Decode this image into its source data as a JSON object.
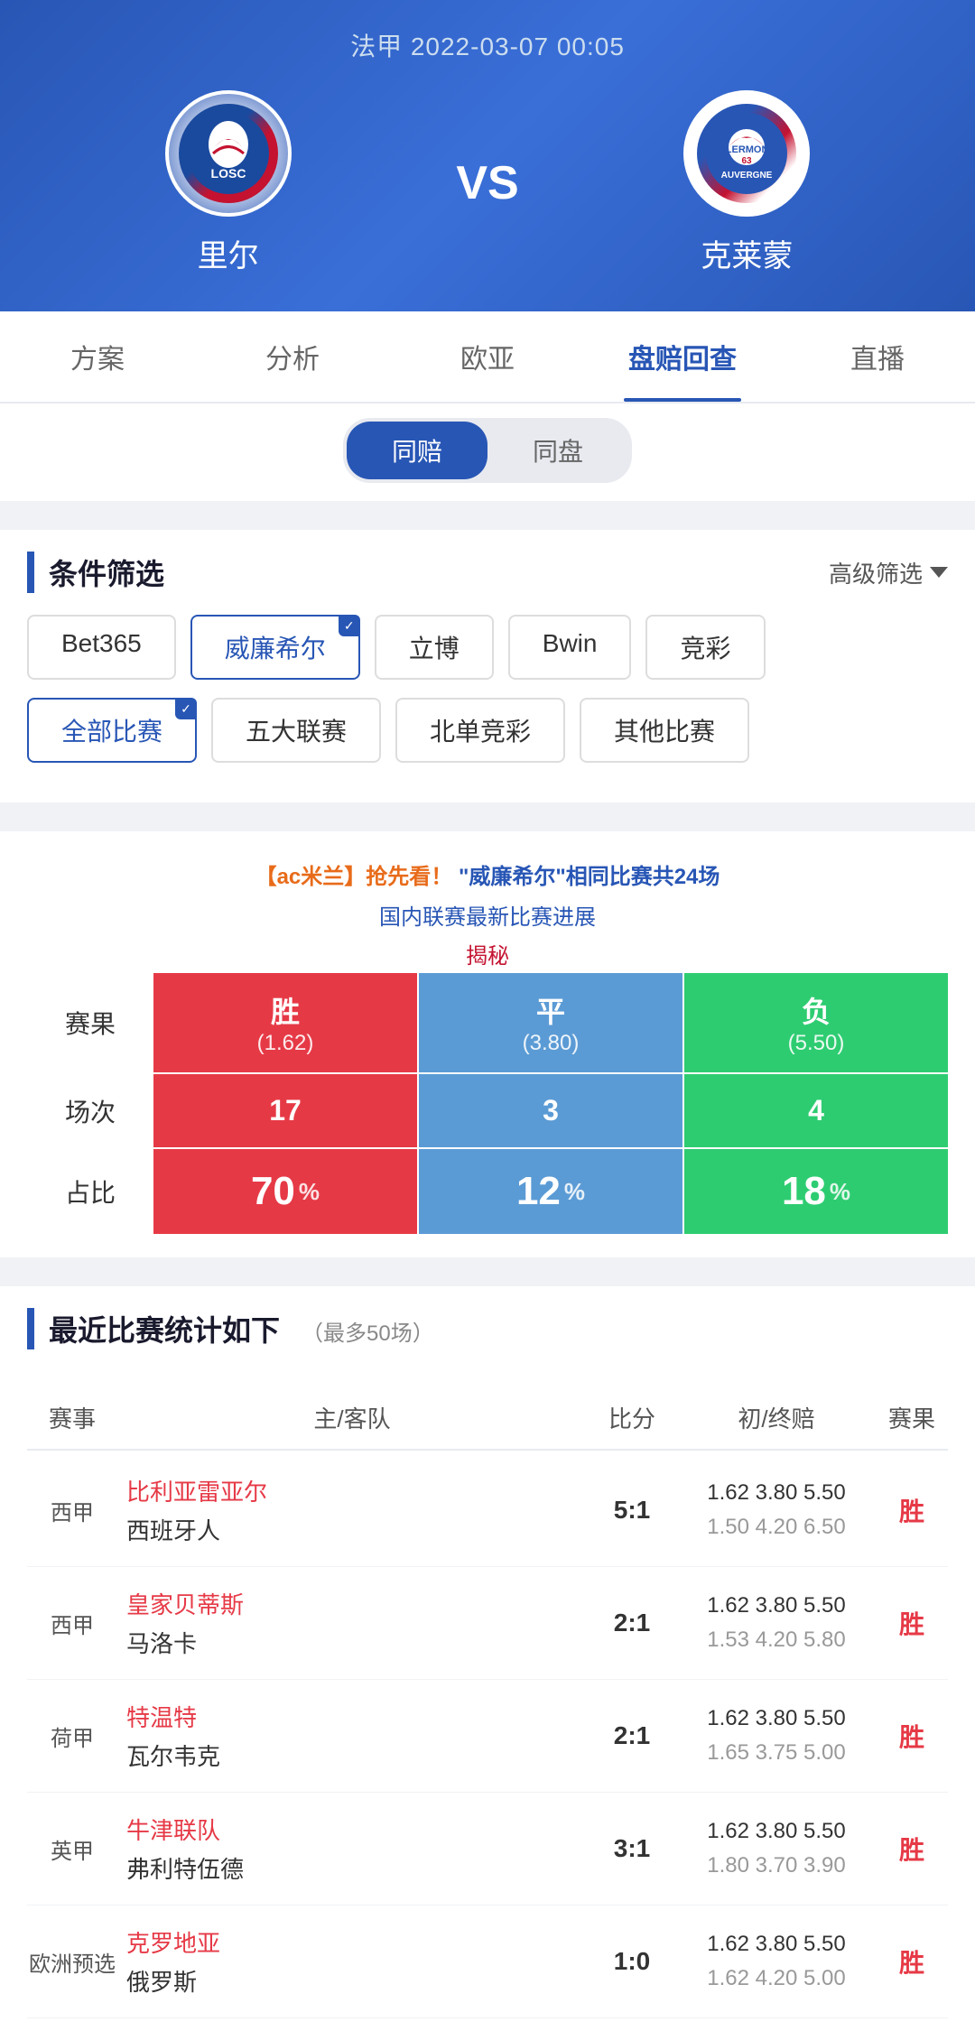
{
  "header": {
    "date": "法甲 2022-03-07 00:05",
    "home_team": "里尔",
    "away_team": "克莱蒙",
    "vs": "VS",
    "home_logo": "LOSC",
    "away_logo": "CF63"
  },
  "nav": {
    "tabs": [
      "方案",
      "分析",
      "欧亚",
      "盘赔回查",
      "直播"
    ],
    "active": "盘赔回查"
  },
  "sub_tabs": {
    "options": [
      "同赔",
      "同盘"
    ],
    "active": "同赔"
  },
  "filter": {
    "title": "条件筛选",
    "advanced_label": "高级筛选",
    "bookmakers": [
      {
        "label": "Bet365",
        "active": false
      },
      {
        "label": "威廉希尔",
        "active": true
      },
      {
        "label": "立博",
        "active": false
      },
      {
        "label": "Bwin",
        "active": false
      },
      {
        "label": "竞彩",
        "active": false
      }
    ],
    "competitions": [
      {
        "label": "全部比赛",
        "active": true
      },
      {
        "label": "五大联赛",
        "active": false
      },
      {
        "label": "北单竞彩",
        "active": false
      },
      {
        "label": "其他比赛",
        "active": false
      }
    ]
  },
  "promo": {
    "line1": "【ac米兰】抢先看！",
    "line2": "国内联赛最新比赛进展",
    "line3": "揭秘"
  },
  "stats": {
    "bookmaker_label": "\"威廉希尔\"相同比赛共24场",
    "outcomes": [
      {
        "label": "胜",
        "odds": "1.62",
        "count": 17,
        "pct": "70"
      },
      {
        "label": "平",
        "odds": "3.80",
        "count": 3,
        "pct": "12"
      },
      {
        "label": "负",
        "odds": "5.50",
        "count": 4,
        "pct": "18"
      }
    ],
    "row_labels": [
      "赛果",
      "场次",
      "占比"
    ]
  },
  "recent": {
    "title": "最近比赛统计如下",
    "subtitle": "（最多50场）",
    "headers": [
      "赛事",
      "主/客队",
      "比分",
      "初/终赔",
      "赛果"
    ],
    "matches": [
      {
        "league": "西甲",
        "home": "比利亚雷亚尔",
        "away": "西班牙人",
        "score": "5:1",
        "odds_initial": "1.62  3.80  5.50",
        "odds_final": "1.50  4.20  6.50",
        "result": "胜"
      },
      {
        "league": "西甲",
        "home": "皇家贝蒂斯",
        "away": "马洛卡",
        "score": "2:1",
        "odds_initial": "1.62  3.80  5.50",
        "odds_final": "1.53  4.20  5.80",
        "result": "胜"
      },
      {
        "league": "荷甲",
        "home": "特温特",
        "away": "瓦尔韦克",
        "score": "2:1",
        "odds_initial": "1.62  3.80  5.50",
        "odds_final": "1.65  3.75  5.00",
        "result": "胜"
      },
      {
        "league": "英甲",
        "home": "牛津联队",
        "away": "弗利特伍德",
        "score": "3:1",
        "odds_initial": "1.62  3.80  5.50",
        "odds_final": "1.80  3.70  3.90",
        "result": "胜"
      },
      {
        "league": "欧洲预选",
        "home": "克罗地亚",
        "away": "俄罗斯",
        "score": "1:0",
        "odds_initial": "1.62  3.80  5.50",
        "odds_final": "1.62  4.20  5.00",
        "result": "胜"
      }
    ]
  }
}
